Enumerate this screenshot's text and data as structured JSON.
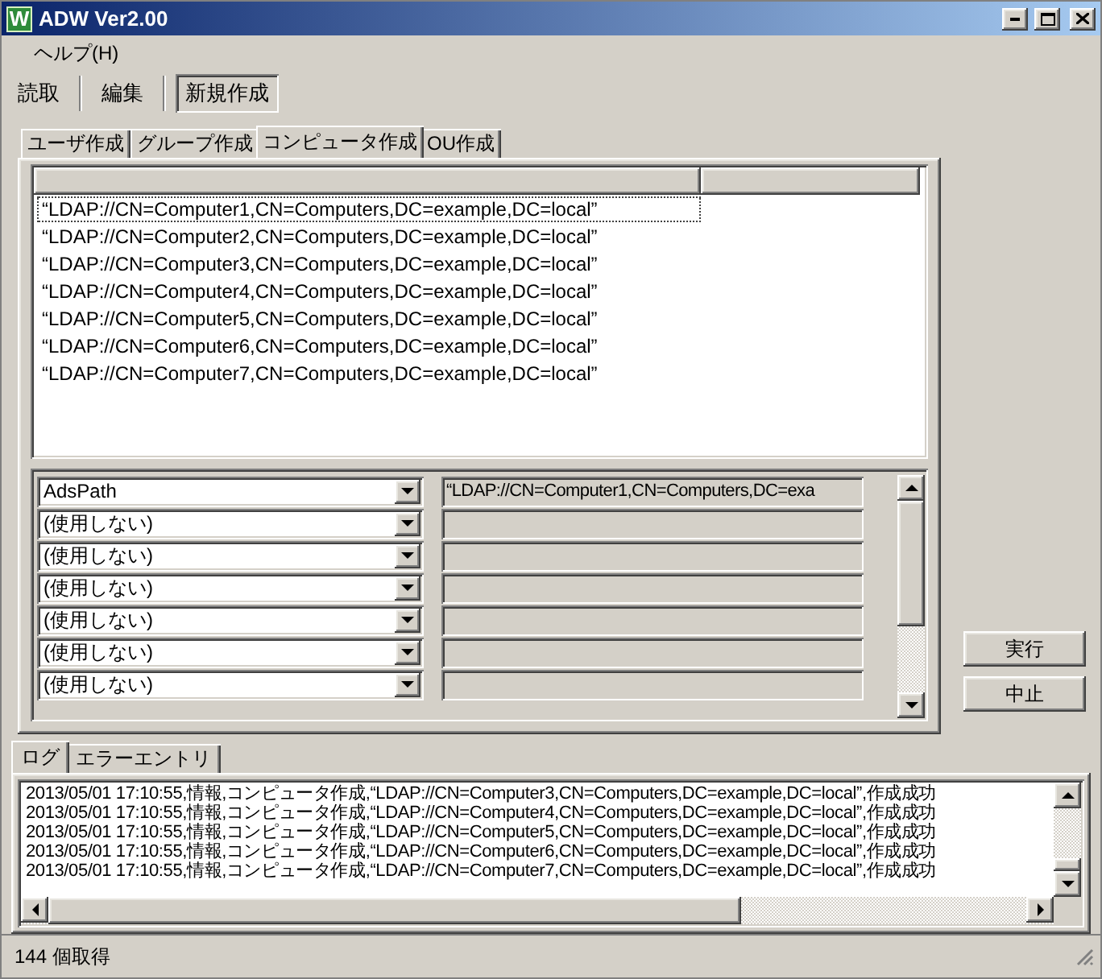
{
  "window": {
    "title": "ADW Ver2.00",
    "icon_letter": "W"
  },
  "menu": [
    {
      "label": "ヘルプ(H)"
    }
  ],
  "toolbar_tabs": [
    {
      "label": "読取",
      "selected": false
    },
    {
      "label": "編集",
      "selected": false
    },
    {
      "label": "新規作成",
      "selected": true
    }
  ],
  "create_tabs": [
    {
      "label": "ユーザ作成",
      "selected": false
    },
    {
      "label": "グループ作成",
      "selected": false
    },
    {
      "label": "コンピュータ作成",
      "selected": true
    },
    {
      "label": "OU作成",
      "selected": false
    }
  ],
  "list": {
    "rows": [
      {
        "text": "“LDAP://CN=Computer1,CN=Computers,DC=example,DC=local”",
        "focused": true
      },
      {
        "text": "“LDAP://CN=Computer2,CN=Computers,DC=example,DC=local”",
        "focused": false
      },
      {
        "text": "“LDAP://CN=Computer3,CN=Computers,DC=example,DC=local”",
        "focused": false
      },
      {
        "text": "“LDAP://CN=Computer4,CN=Computers,DC=example,DC=local”",
        "focused": false
      },
      {
        "text": "“LDAP://CN=Computer5,CN=Computers,DC=example,DC=local”",
        "focused": false
      },
      {
        "text": "“LDAP://CN=Computer6,CN=Computers,DC=example,DC=local”",
        "focused": false
      },
      {
        "text": "“LDAP://CN=Computer7,CN=Computers,DC=example,DC=local”",
        "focused": false
      }
    ]
  },
  "mapping": [
    {
      "attribute": "AdsPath",
      "value": "“LDAP://CN=Computer1,CN=Computers,DC=exa"
    },
    {
      "attribute": "(使用しない)"
    },
    {
      "attribute": "(使用しない)"
    },
    {
      "attribute": "(使用しない)"
    },
    {
      "attribute": "(使用しない)"
    },
    {
      "attribute": "(使用しない)"
    },
    {
      "attribute": "(使用しない)"
    }
  ],
  "buttons": [
    {
      "label": "実行"
    },
    {
      "label": "中止"
    }
  ],
  "log_tabs": [
    {
      "label": "ログ",
      "selected": true
    },
    {
      "label": "エラーエントリ",
      "selected": false
    }
  ],
  "log_lines": [
    "2013/05/01 17:10:55,情報,コンピュータ作成,“LDAP://CN=Computer3,CN=Computers,DC=example,DC=local”,作成成功",
    "2013/05/01 17:10:55,情報,コンピュータ作成,“LDAP://CN=Computer4,CN=Computers,DC=example,DC=local”,作成成功",
    "2013/05/01 17:10:55,情報,コンピュータ作成,“LDAP://CN=Computer5,CN=Computers,DC=example,DC=local”,作成成功",
    "2013/05/01 17:10:55,情報,コンピュータ作成,“LDAP://CN=Computer6,CN=Computers,DC=example,DC=local”,作成成功",
    "2013/05/01 17:10:55,情報,コンピュータ作成,“LDAP://CN=Computer7,CN=Computers,DC=example,DC=local”,作成成功"
  ],
  "status": "144 個取得"
}
